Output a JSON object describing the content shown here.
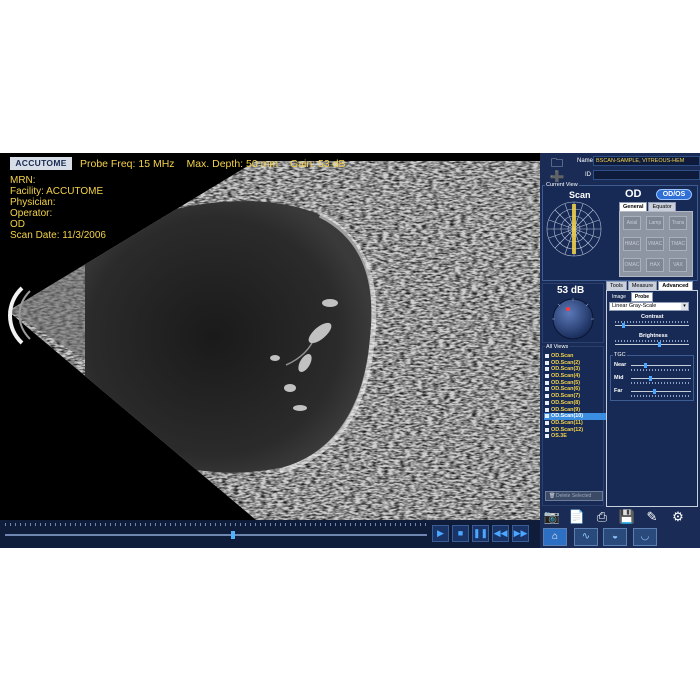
{
  "header": {
    "logo": "ACCUTOME",
    "probe_freq": "Probe Freq: 15 MHz",
    "max_depth": "Max. Depth: 50 mm",
    "gain": "Gain: 53 dB"
  },
  "patient_info": {
    "mrn": "MRN:",
    "facility": "Facility: ACCUTOME",
    "physician": "Physician:",
    "operator": "Operator:",
    "eye": "OD",
    "scan_date": "Scan Date: 11/3/2006"
  },
  "player": {
    "progress": 0.54
  },
  "panel": {
    "name_label": "Name",
    "name_value": "BSCAN-SAMPLE, VITREOUS-HEM",
    "id_label": "ID",
    "id_value": "",
    "current_view": {
      "title": "Current View",
      "mode": "Scan",
      "eye": "OD",
      "toggle": "OD/OS",
      "tabs": [
        "General",
        "Equator"
      ],
      "buttons": [
        "Axial",
        "Lamp",
        "Trans",
        "HMAC",
        "VMAC",
        "TMAC",
        "OMAC",
        "HAX",
        "VAX"
      ]
    },
    "gain": {
      "value": "53 dB",
      "level": 0.53
    },
    "all_views": {
      "title": "All Views",
      "items": [
        "OD.Scan",
        "OD.Scan(2)",
        "OD.Scan(3)",
        "OD.Scan(4)",
        "OD.Scan(5)",
        "OD.Scan(6)",
        "OD.Scan(7)",
        "OD.Scan(8)",
        "OD.Scan(9)",
        "OD.Scan(10)",
        "OD.Scan(11)",
        "OD.Scan(12)",
        "OS.3E"
      ],
      "selected_index": 9,
      "delete_label": "Delete Selected"
    },
    "settings": {
      "tabs": [
        "Tools",
        "Measure",
        "Advanced"
      ],
      "subtabs": [
        "Image",
        "Probe"
      ],
      "map_select": "Linear Gray-Scale",
      "contrast_label": "Contrast",
      "brightness_label": "Brightness",
      "tgc_title": "TGC",
      "near_label": "Near",
      "mid_label": "Mid",
      "far_label": "Far",
      "contrast_level": 0.1,
      "brightness_level": 0.6,
      "near_level": 0.22,
      "mid_level": 0.32,
      "far_level": 0.38
    }
  },
  "icons": {
    "open": "folder-icon",
    "new_patient": "add-user-icon",
    "camera": "camera-icon",
    "report": "document-icon",
    "print": "printer-icon",
    "save": "floppy-disk-icon",
    "annotate": "pen-icon",
    "settings": "gear-icon",
    "home": "home-icon",
    "a_mode": "a-scan-icon",
    "b_mode": "b-scan-icon",
    "ubm": "ubm-icon",
    "play": "play-icon",
    "stop": "stop-icon",
    "pause": "pause-icon",
    "rewind": "rewind-icon",
    "fast_forward": "fast-forward-icon"
  },
  "colors": {
    "accent": "#3a8de0",
    "info_text": "#f3d24a",
    "panel_bg": "#1a2c56"
  }
}
